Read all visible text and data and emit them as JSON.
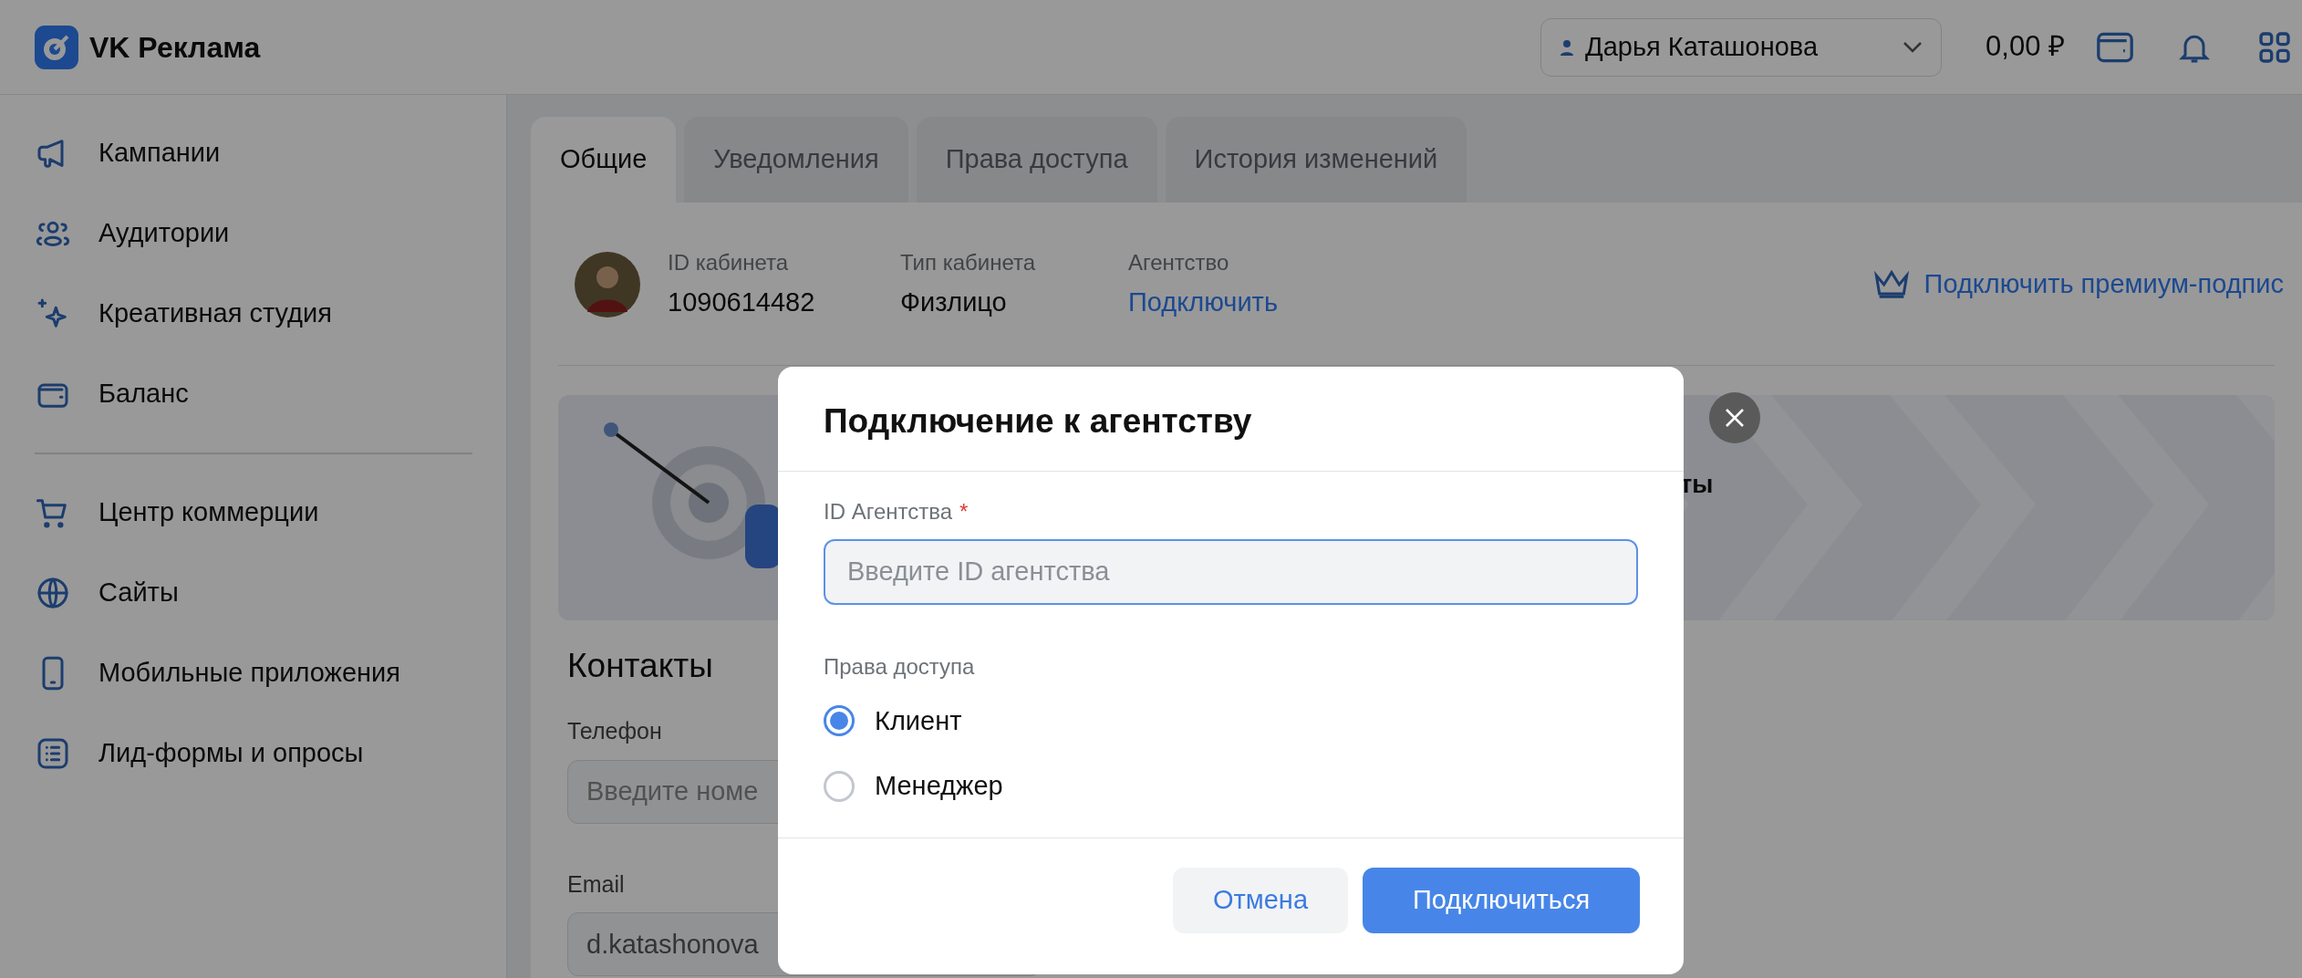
{
  "header": {
    "logo_text": "VK Реклама",
    "user": "Дарья Каташонова",
    "balance": "0,00 ₽"
  },
  "sidebar": {
    "items": [
      {
        "label": "Кампании",
        "divider_before": false
      },
      {
        "label": "Аудитории",
        "divider_before": false
      },
      {
        "label": "Креативная студия",
        "divider_before": false
      },
      {
        "label": "Баланс",
        "divider_before": false
      },
      {
        "label": "Центр коммерции",
        "divider_before": true
      },
      {
        "label": "Сайты",
        "divider_before": false
      },
      {
        "label": "Мобильные приложения",
        "divider_before": false
      },
      {
        "label": "Лид-формы и опросы",
        "divider_before": false
      }
    ]
  },
  "tabs": [
    {
      "label": "Общие",
      "selected": true
    },
    {
      "label": "Уведомления",
      "selected": false
    },
    {
      "label": "Права доступа",
      "selected": false
    },
    {
      "label": "История изменений",
      "selected": false
    }
  ],
  "account": {
    "fields": [
      {
        "label": "ID кабинета",
        "value": "1090614482",
        "kind": "text"
      },
      {
        "label": "Тип кабинета",
        "value": "Физлицо",
        "kind": "text"
      },
      {
        "label": "Агентство",
        "value": "Подключить",
        "kind": "link"
      }
    ],
    "premium_link": "Подключить премиум-подпис"
  },
  "banner": {
    "text": "ты"
  },
  "contacts": {
    "title": "Контакты",
    "fields": [
      {
        "label": "Телефон",
        "placeholder": "Введите номе"
      },
      {
        "label": "Email",
        "value": "d.katashonova"
      }
    ]
  },
  "dialog": {
    "title": "Подключение к агентству",
    "id_field": {
      "label": "ID Агентства",
      "required_mark": "*",
      "placeholder": "Введите ID агентства"
    },
    "access": {
      "label": "Права доступа",
      "options": [
        {
          "label": "Клиент",
          "selected": true
        },
        {
          "label": "Менеджер",
          "selected": false
        }
      ]
    },
    "buttons": [
      {
        "label": "Отмена",
        "kind": "secondary"
      },
      {
        "label": "Подключиться",
        "kind": "primary"
      }
    ]
  }
}
